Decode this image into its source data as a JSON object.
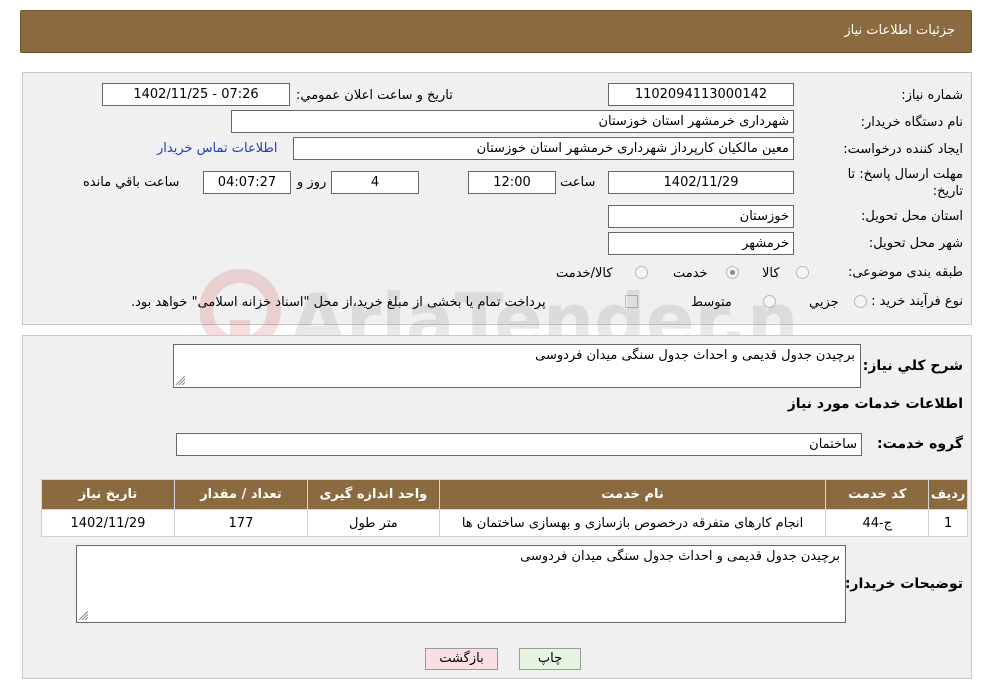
{
  "header": {
    "title": "جزئیات اطلاعات نیاز"
  },
  "form": {
    "need_number": {
      "label": "شماره نیاز:",
      "value": "1102094113000142"
    },
    "announce_datetime": {
      "label": "تاریخ و ساعت اعلان عمومي:",
      "value": "1402/11/25 - 07:26"
    },
    "buyer_org": {
      "label": "نام دستگاه خريدار:",
      "value": "شهرداری خرمشهر استان خوزستان"
    },
    "requester": {
      "label": "ايجاد کننده درخواست:",
      "value": "معین مالکیان کارپرداز شهرداری خرمشهر استان خوزستان",
      "contact_link": "اطلاعات تماس خريدار"
    },
    "deadline": {
      "label": "مهلت ارسال پاسخ: تا تاريخ:",
      "date": "1402/11/29",
      "time_label": "ساعت",
      "time": "12:00",
      "days": "4",
      "days_label": "روز و",
      "remaining": "04:07:27",
      "remaining_label": "ساعت باقي مانده"
    },
    "province": {
      "label": "استان محل تحويل:",
      "value": "خوزستان"
    },
    "city": {
      "label": "شهر محل تحويل:",
      "value": "خرمشهر"
    },
    "category": {
      "label": "طبقه بندی موضوعی:",
      "options": [
        {
          "label": "کالا",
          "checked": false
        },
        {
          "label": "خدمت",
          "checked": true
        },
        {
          "label": "کالا/خدمت",
          "checked": false
        }
      ]
    },
    "purchase_type": {
      "label": "نوع فرآيند خريد :",
      "options": [
        {
          "label": "جزيي",
          "checked": false
        },
        {
          "label": "متوسط",
          "checked": false
        }
      ],
      "payment_note": "پرداخت تمام يا بخشی از مبلغ خريد،از محل \"اسناد خزانه اسلامی\" خواهد بود.",
      "payment_checked": false
    }
  },
  "details": {
    "general_desc_label": "شرح کلي نياز:",
    "general_desc": "برچیدن جدول قدیمی و احداث جدول سنگی میدان فردوسی",
    "services_heading": "اطلاعات خدمات مورد نياز",
    "service_group_label": "گروه خدمت:",
    "service_group": "ساختمان",
    "table": {
      "columns": [
        "رديف",
        "کد خدمت",
        "نام خدمت",
        "واحد اندازه گيری",
        "تعداد / مقدار",
        "تاريخ نياز"
      ],
      "rows": [
        [
          "1",
          "ج-44",
          "انجام کارهای متفرقه درخصوص بازسازی و بهسازی ساختمان ها",
          "متر طول",
          "177",
          "1402/11/29"
        ]
      ]
    },
    "buyer_notes_label": "توضيحات خريدار:",
    "buyer_notes": "برچیدن جدول قدیمی و احداث جدول سنگی میدان فردوسی"
  },
  "buttons": {
    "print": "چاپ",
    "back": "بازگشت"
  },
  "watermark": {
    "text": "AriaTender.neT"
  }
}
